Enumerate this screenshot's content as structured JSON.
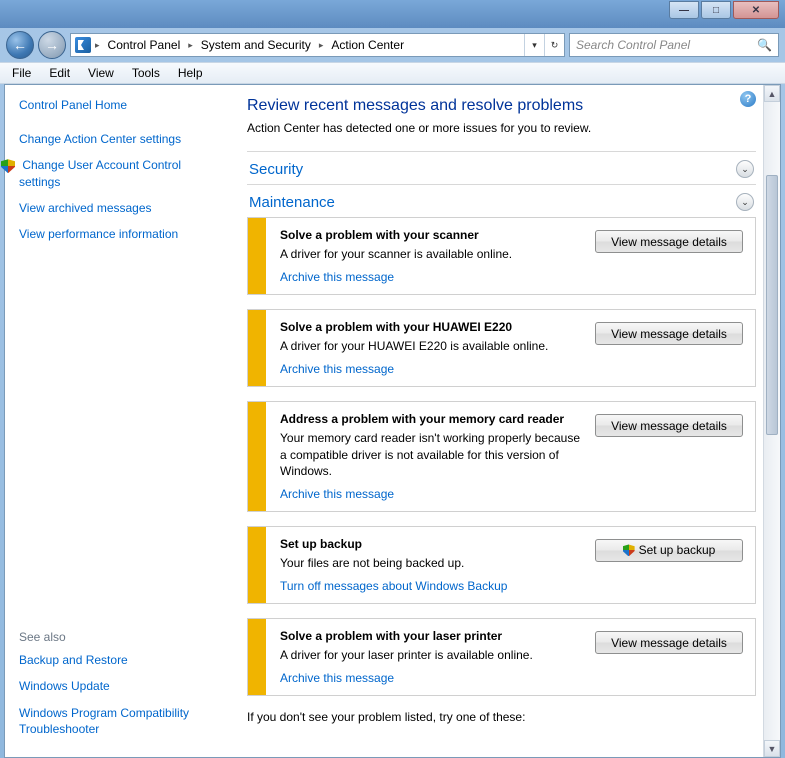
{
  "window": {
    "minimize": "—",
    "maximize": "□",
    "close": "✕"
  },
  "nav": {
    "back": "←",
    "forward": "→",
    "dropdown": "▾",
    "refresh": "↻"
  },
  "breadcrumbs": {
    "root_sep": "▸",
    "items": [
      "Control Panel",
      "System and Security",
      "Action Center"
    ]
  },
  "search": {
    "placeholder": "Search Control Panel",
    "icon": "🔍"
  },
  "menubar": [
    "File",
    "Edit",
    "View",
    "Tools",
    "Help"
  ],
  "sidebar": {
    "home": "Control Panel Home",
    "links": [
      "Change Action Center settings",
      "Change User Account Control settings",
      "View archived messages",
      "View performance information"
    ],
    "seealso_title": "See also",
    "seealso": [
      "Backup and Restore",
      "Windows Update",
      "Windows Program Compatibility Troubleshooter"
    ]
  },
  "page": {
    "help": "?",
    "title": "Review recent messages and resolve problems",
    "subtitle": "Action Center has detected one or more issues for you to review.",
    "sections": {
      "security": "Security",
      "maintenance": "Maintenance"
    },
    "chevron": "⌄"
  },
  "messages": [
    {
      "title": "Solve a problem with your scanner",
      "desc": "A driver for your scanner is available online.",
      "link": "Archive this message",
      "button": "View message details",
      "shield": false
    },
    {
      "title": "Solve a problem with your HUAWEI E220",
      "desc": "A driver for your HUAWEI E220 is available online.",
      "link": "Archive this message",
      "button": "View message details",
      "shield": false
    },
    {
      "title": "Address a problem with your memory card reader",
      "desc": "Your memory card reader isn't working properly because a compatible driver is not available for this version of Windows.",
      "link": "Archive this message",
      "button": "View message details",
      "shield": false
    },
    {
      "title": "Set up backup",
      "desc": "Your files are not being backed up.",
      "link": "Turn off messages about Windows Backup",
      "button": "Set up backup",
      "shield": true
    },
    {
      "title": "Solve a problem with your laser printer",
      "desc": "A driver for your laser printer is available online.",
      "link": "Archive this message",
      "button": "View message details",
      "shield": false
    }
  ],
  "footer": "If you don't see your problem listed, try one of these:"
}
